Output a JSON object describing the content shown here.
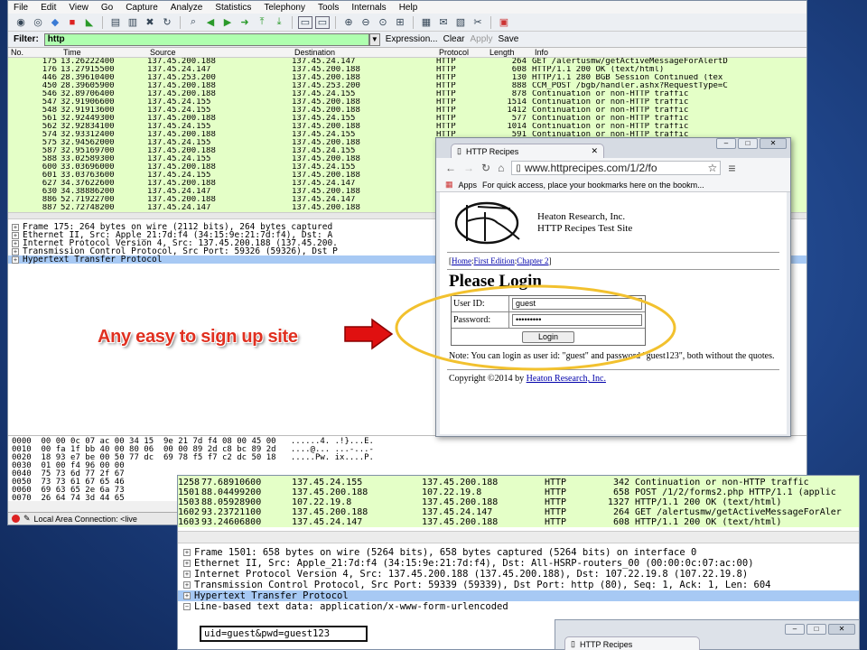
{
  "menu": [
    "File",
    "Edit",
    "View",
    "Go",
    "Capture",
    "Analyze",
    "Statistics",
    "Telephony",
    "Tools",
    "Internals",
    "Help"
  ],
  "filter": {
    "label": "Filter:",
    "value": "http",
    "expression": "Expression...",
    "clear": "Clear",
    "apply": "Apply",
    "save": "Save"
  },
  "columns": [
    "No.",
    "Time",
    "Source",
    "Destination",
    "Protocol",
    "Length",
    "Info"
  ],
  "packets": [
    {
      "no": "175",
      "time": "13.26222400",
      "src": "137.45.200.188",
      "dst": "137.45.24.147",
      "proto": "HTTP",
      "len": "264",
      "info": "GET /alertusmw/getActiveMessageForAlertD"
    },
    {
      "no": "176",
      "time": "13.27915500",
      "src": "137.45.24.147",
      "dst": "137.45.200.188",
      "proto": "HTTP",
      "len": "608",
      "info": "HTTP/1.1 200 OK  (text/html)"
    },
    {
      "no": "446",
      "time": "28.39610400",
      "src": "137.45.253.200",
      "dst": "137.45.200.188",
      "proto": "HTTP",
      "len": "130",
      "info": "HTTP/1.1 280 BGB Session Continued  (tex"
    },
    {
      "no": "450",
      "time": "28.39605900",
      "src": "137.45.200.188",
      "dst": "137.45.253.200",
      "proto": "HTTP",
      "len": "888",
      "info": "CCM_POST /bgb/handler.ashx?RequestType=C"
    },
    {
      "no": "546",
      "time": "32.89706400",
      "src": "137.45.200.188",
      "dst": "137.45.24.155",
      "proto": "HTTP",
      "len": "878",
      "info": "Continuation or non-HTTP traffic"
    },
    {
      "no": "547",
      "time": "32.91906600",
      "src": "137.45.24.155",
      "dst": "137.45.200.188",
      "proto": "HTTP",
      "len": "1514",
      "info": "Continuation or non-HTTP traffic"
    },
    {
      "no": "548",
      "time": "32.91913600",
      "src": "137.45.24.155",
      "dst": "137.45.200.188",
      "proto": "HTTP",
      "len": "1412",
      "info": "Continuation or non-HTTP traffic"
    },
    {
      "no": "561",
      "time": "32.92449300",
      "src": "137.45.200.188",
      "dst": "137.45.24.155",
      "proto": "HTTP",
      "len": "577",
      "info": "Continuation or non-HTTP traffic"
    },
    {
      "no": "562",
      "time": "32.92834100",
      "src": "137.45.24.155",
      "dst": "137.45.200.188",
      "proto": "HTTP",
      "len": "1014",
      "info": "Continuation or non-HTTP traffic"
    },
    {
      "no": "574",
      "time": "32.93312400",
      "src": "137.45.200.188",
      "dst": "137.45.24.155",
      "proto": "HTTP",
      "len": "591",
      "info": "Continuation or non-HTTP traffic"
    },
    {
      "no": "575",
      "time": "32.94562000",
      "src": "137.45.24.155",
      "dst": "137.45.200.188",
      "proto": "HTTP",
      "len": "",
      "info": ""
    },
    {
      "no": "587",
      "time": "32.95169700",
      "src": "137.45.200.188",
      "dst": "137.45.24.155",
      "proto": "HTTP",
      "len": "",
      "info": ""
    },
    {
      "no": "588",
      "time": "33.02589300",
      "src": "137.45.24.155",
      "dst": "137.45.200.188",
      "proto": "HTTP",
      "len": "",
      "info": ""
    },
    {
      "no": "600",
      "time": "33.03696000",
      "src": "137.45.200.188",
      "dst": "137.45.24.155",
      "proto": "HTTP",
      "len": "",
      "info": ""
    },
    {
      "no": "601",
      "time": "33.03763600",
      "src": "137.45.24.155",
      "dst": "137.45.200.188",
      "proto": "HTTP",
      "len": "",
      "info": ""
    },
    {
      "no": "627",
      "time": "34.37622600",
      "src": "137.45.200.188",
      "dst": "137.45.24.147",
      "proto": "HTTP",
      "len": "",
      "info": ""
    },
    {
      "no": "630",
      "time": "34.38886200",
      "src": "137.45.24.147",
      "dst": "137.45.200.188",
      "proto": "HTTP",
      "len": "",
      "info": ""
    },
    {
      "no": "886",
      "time": "52.71922700",
      "src": "137.45.200.188",
      "dst": "137.45.24.147",
      "proto": "HTTP",
      "len": "",
      "info": ""
    },
    {
      "no": "887",
      "time": "52.72748200",
      "src": "137.45.24.147",
      "dst": "137.45.200.188",
      "proto": "HTTP",
      "len": "",
      "info": ""
    }
  ],
  "details": [
    "Frame 175: 264 bytes on wire (2112 bits), 264 bytes captured",
    "Ethernet II, Src: Apple_21:7d:f4 (34:15:9e:21:7d:f4), Dst: A",
    "Internet Protocol Version 4, Src: 137.45.200.188 (137.45.200.",
    "Transmission Control Protocol, Src Port: 59326 (59326), Dst P",
    "Hypertext Transfer Protocol"
  ],
  "hex": [
    "0000  00 00 0c 07 ac 00 34 15  9e 21 7d f4 08 00 45 00   ......4. .!}...E.",
    "0010  00 fa 1f bb 40 00 80 06  00 00 89 2d c8 bc 89 2d   ....@... ...-...-",
    "0020  18 93 e7 be 00 50 77 dc  69 78 f5 f7 c2 dc 50 18   .....Pw. ix....P.",
    "0030  01 00 f4 96 00 00",
    "0040  75 73 6d 77 2f 67",
    "0050  73 73 61 67 65 46",
    "0060  69 63 65 2e 6a 73",
    "0070  26 64 74 3d 44 65"
  ],
  "status": "Local Area Connection: <live",
  "caption": "Any easy to sign up site",
  "browser": {
    "tab_title": "HTTP Recipes",
    "url": "www.httprecipes.com/1/2/fo",
    "apps": "Apps",
    "bookmarks_hint": "For quick access, place your bookmarks here on the bookm...",
    "org_line1": "Heaton Research, Inc.",
    "org_line2": "HTTP Recipes Test Site",
    "crumb_home": "Home",
    "crumb_first": "First Edition",
    "crumb_ch": "Chapter 2",
    "title": "Please Login",
    "uid_label": "User ID:",
    "uid_value": "guest",
    "pwd_label": "Password:",
    "pwd_value": "•••••••••",
    "login_btn": "Login",
    "note": "Note: You can login as user id: \"guest\" and password \"guest123\", both without the quotes.",
    "copy_pre": "Copyright ©2014 by ",
    "copy_link": "Heaton Research, Inc."
  },
  "ws2": {
    "packets": [
      {
        "no": "1258",
        "time": "77.68910600",
        "src": "137.45.24.155",
        "dst": "137.45.200.188",
        "proto": "HTTP",
        "len": "342",
        "info": "Continuation or non-HTTP traffic"
      },
      {
        "no": "1501",
        "time": "88.04499200",
        "src": "137.45.200.188",
        "dst": "107.22.19.8",
        "proto": "HTTP",
        "len": "658",
        "info": "POST /1/2/forms2.php HTTP/1.1  (applic"
      },
      {
        "no": "1503",
        "time": "88.05928900",
        "src": "107.22.19.8",
        "dst": "137.45.200.188",
        "proto": "HTTP",
        "len": "1327",
        "info": "HTTP/1.1 200 OK  (text/html)"
      },
      {
        "no": "1602",
        "time": "93.23721100",
        "src": "137.45.200.188",
        "dst": "137.45.24.147",
        "proto": "HTTP",
        "len": "264",
        "info": "GET /alertusmw/getActiveMessageForAler"
      },
      {
        "no": "1603",
        "time": "93.24606800",
        "src": "137.45.24.147",
        "dst": "137.45.200.188",
        "proto": "HTTP",
        "len": "608",
        "info": "HTTP/1.1 200 OK  (text/html)"
      }
    ],
    "details": [
      "Frame 1501: 658 bytes on wire (5264 bits), 658 bytes captured (5264 bits) on interface 0",
      "Ethernet II, Src: Apple_21:7d:f4 (34:15:9e:21:7d:f4), Dst: All-HSRP-routers_00 (00:00:0c:07:ac:00)",
      "Internet Protocol Version 4, Src: 137.45.200.188 (137.45.200.188), Dst: 107.22.19.8 (107.22.19.8)",
      "Transmission Control Protocol, Src Port: 59339 (59339), Dst Port: http (80), Seq: 1, Ack: 1, Len: 604",
      "Hypertext Transfer Protocol",
      "Line-based text data: application/x-www-form-urlencoded"
    ],
    "uid_payload": "uid=guest&pwd=guest123",
    "tab_title": "HTTP Recipes"
  },
  "colors": {
    "caption": "#e03020",
    "green_row": "#e4ffc7",
    "selected": "#a7c9f4",
    "ellipse": "#f2c12e",
    "arrow": "#e01010"
  }
}
